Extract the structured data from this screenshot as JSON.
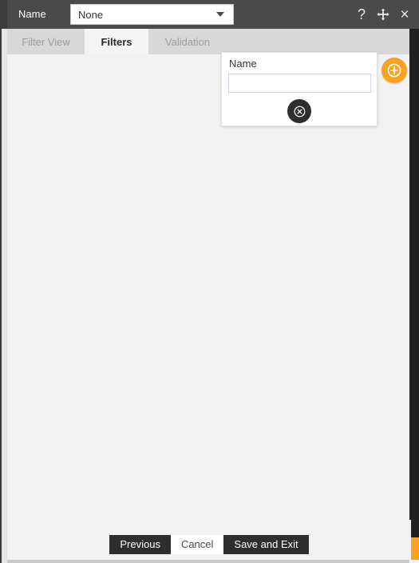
{
  "titlebar": {
    "label": "Name",
    "select": {
      "value": "None",
      "icon": "chevron-down-icon"
    },
    "actions": [
      {
        "name": "help-icon",
        "glyph": "?",
        "title": "Help"
      },
      {
        "name": "move-icon",
        "glyph": "move",
        "title": "Move"
      },
      {
        "name": "close-icon",
        "glyph": "×",
        "title": "Close"
      }
    ]
  },
  "tabs": [
    {
      "label": "Filter View",
      "active": false
    },
    {
      "label": "Filters",
      "active": true
    },
    {
      "label": "Validation",
      "active": false
    }
  ],
  "filter_card": {
    "label": "Name",
    "input_value": "",
    "input_placeholder": "",
    "remove_icon": "circle-x-icon"
  },
  "add_filter": {
    "icon": "circle-plus-icon",
    "title": "Add filter"
  },
  "scrollbar": {
    "orientation": "vertical",
    "thumb_color": "#f7a220",
    "track_color": "#1f2123"
  },
  "footer": {
    "buttons": [
      {
        "label": "Previous",
        "style": "dark"
      },
      {
        "label": "Cancel",
        "style": "light"
      },
      {
        "label": "Save and Exit",
        "style": "dark"
      }
    ]
  },
  "colors": {
    "accent": "#f7a220",
    "titlebar": "#4a4a4a",
    "tabstrip": "#d8d8d8",
    "canvas": "#f2f2f2",
    "dark_button": "#2e2e2e"
  }
}
